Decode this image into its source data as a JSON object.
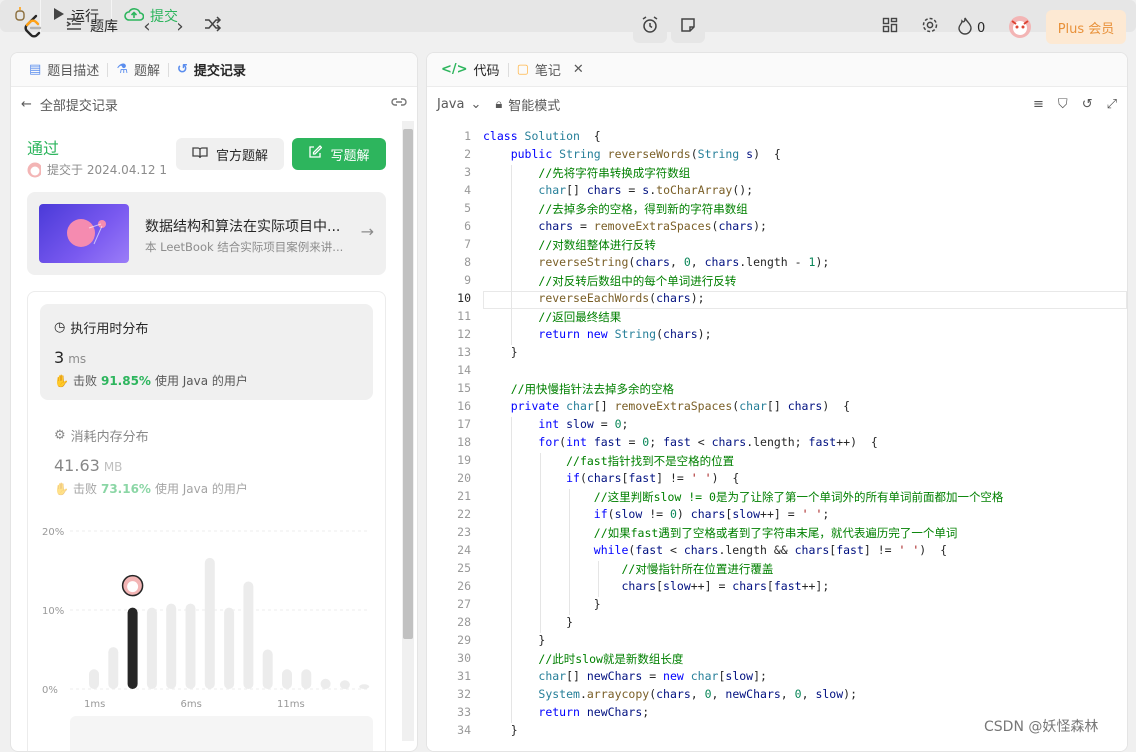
{
  "topbar": {
    "problem_bank": "题库",
    "run": "运行",
    "submit": "提交",
    "fire_count": "0",
    "plus": "Plus 会员"
  },
  "left": {
    "tabs": [
      "题目描述",
      "题解",
      "提交记录"
    ],
    "back_label": "全部提交记录",
    "status": "通过",
    "submit_time": "提交于 2024.04.12 1",
    "official_solution": "官方题解",
    "write_solution": "写题解",
    "card": {
      "title": "数据结构和算法在实际项目中...",
      "desc": "本 LeetBook 结合实际项目案例来讲..."
    },
    "runtime": {
      "label": "执行用时分布",
      "value": "3",
      "unit": "ms",
      "beat_prefix": "击败",
      "beat": "91.85%",
      "beat_suffix": "使用 Java 的用户"
    },
    "memory": {
      "label": "消耗内存分布",
      "value": "41.63",
      "unit": "MB",
      "beat_prefix": "击败",
      "beat": "73.16%",
      "beat_suffix": "使用 Java 的用户"
    }
  },
  "chart_data": {
    "type": "bar",
    "y_ticks": [
      "20%",
      "10%",
      "0%"
    ],
    "x_ticks": [
      "1ms",
      "6ms",
      "11ms"
    ],
    "ylim": [
      0,
      20
    ],
    "values": [
      2.5,
      5.3,
      10.3,
      10.3,
      10.8,
      10.8,
      16.6,
      10.3,
      13.6,
      5,
      2.5,
      2.5,
      1.3,
      1.1,
      0.6
    ],
    "highlight_index": 2
  },
  "right": {
    "tabs": [
      "代码",
      "笔记"
    ],
    "language": "Java",
    "mode": "智能模式",
    "active_line": 10,
    "lines": [
      [
        [
          "kw",
          "class "
        ],
        [
          "ty",
          "Solution"
        ],
        [
          "",
          "  {"
        ]
      ],
      [
        [
          "",
          "    "
        ],
        [
          "kw",
          "public "
        ],
        [
          "ty",
          "String "
        ],
        [
          "fn",
          "reverseWords"
        ],
        [
          "",
          "("
        ],
        [
          "ty",
          "String "
        ],
        [
          "vr",
          "s"
        ],
        [
          "",
          ")  {"
        ]
      ],
      [
        [
          "",
          "        "
        ],
        [
          "cm",
          "//先将字符串转换成字符数组"
        ]
      ],
      [
        [
          "",
          "        "
        ],
        [
          "ty",
          "char"
        ],
        [
          "",
          "[] "
        ],
        [
          "vr",
          "chars"
        ],
        [
          "",
          " = "
        ],
        [
          "vr",
          "s"
        ],
        [
          "",
          "."
        ],
        [
          "fn",
          "toCharArray"
        ],
        [
          "",
          "();"
        ]
      ],
      [
        [
          "",
          "        "
        ],
        [
          "cm",
          "//去掉多余的空格，得到新的字符串数组"
        ]
      ],
      [
        [
          "",
          "        "
        ],
        [
          "vr",
          "chars"
        ],
        [
          "",
          " = "
        ],
        [
          "fn",
          "removeExtraSpaces"
        ],
        [
          "",
          "("
        ],
        [
          "vr",
          "chars"
        ],
        [
          "",
          ");"
        ]
      ],
      [
        [
          "",
          "        "
        ],
        [
          "cm",
          "//对数组整体进行反转"
        ]
      ],
      [
        [
          "",
          "        "
        ],
        [
          "fn",
          "reverseString"
        ],
        [
          "",
          "("
        ],
        [
          "vr",
          "chars"
        ],
        [
          "",
          ", "
        ],
        [
          "nm",
          "0"
        ],
        [
          "",
          ", "
        ],
        [
          "vr",
          "chars"
        ],
        [
          "",
          ".length - "
        ],
        [
          "nm",
          "1"
        ],
        [
          "",
          ");"
        ]
      ],
      [
        [
          "",
          "        "
        ],
        [
          "cm",
          "//对反转后数组中的每个单词进行反转"
        ]
      ],
      [
        [
          "",
          "        "
        ],
        [
          "fn",
          "reverseEachWords"
        ],
        [
          "",
          "("
        ],
        [
          "vr",
          "chars"
        ],
        [
          "",
          ");"
        ]
      ],
      [
        [
          "",
          "        "
        ],
        [
          "cm",
          "//返回最终结果"
        ]
      ],
      [
        [
          "",
          "        "
        ],
        [
          "kw",
          "return "
        ],
        [
          "kw",
          "new "
        ],
        [
          "ty",
          "String"
        ],
        [
          "",
          "("
        ],
        [
          "vr",
          "chars"
        ],
        [
          "",
          ");"
        ]
      ],
      [
        [
          "",
          "    }"
        ]
      ],
      [
        [
          "",
          ""
        ]
      ],
      [
        [
          "",
          "    "
        ],
        [
          "cm",
          "//用快慢指针法去掉多余的空格"
        ]
      ],
      [
        [
          "",
          "    "
        ],
        [
          "kw",
          "private "
        ],
        [
          "ty",
          "char"
        ],
        [
          "",
          "[] "
        ],
        [
          "fn",
          "removeExtraSpaces"
        ],
        [
          "",
          "("
        ],
        [
          "ty",
          "char"
        ],
        [
          "",
          "[] "
        ],
        [
          "vr",
          "chars"
        ],
        [
          "",
          ")  {"
        ]
      ],
      [
        [
          "",
          "        "
        ],
        [
          "kw",
          "int "
        ],
        [
          "vr",
          "slow"
        ],
        [
          "",
          " = "
        ],
        [
          "nm",
          "0"
        ],
        [
          "",
          ";"
        ]
      ],
      [
        [
          "",
          "        "
        ],
        [
          "kw",
          "for"
        ],
        [
          "",
          "("
        ],
        [
          "kw",
          "int "
        ],
        [
          "vr",
          "fast"
        ],
        [
          "",
          " = "
        ],
        [
          "nm",
          "0"
        ],
        [
          "",
          "; "
        ],
        [
          "vr",
          "fast"
        ],
        [
          "",
          " < "
        ],
        [
          "vr",
          "chars"
        ],
        [
          "",
          ".length; "
        ],
        [
          "vr",
          "fast"
        ],
        [
          "",
          "++)  {"
        ]
      ],
      [
        [
          "",
          "            "
        ],
        [
          "cm",
          "//fast指针找到不是空格的位置"
        ]
      ],
      [
        [
          "",
          "            "
        ],
        [
          "kw",
          "if"
        ],
        [
          "",
          "("
        ],
        [
          "vr",
          "chars"
        ],
        [
          "",
          "["
        ],
        [
          "vr",
          "fast"
        ],
        [
          "",
          "] != "
        ],
        [
          "st",
          "' '"
        ],
        [
          "",
          ")  {"
        ]
      ],
      [
        [
          "",
          "                "
        ],
        [
          "cm",
          "//这里判断slow != 0是为了让除了第一个单词外的所有单词前面都加一个空格"
        ]
      ],
      [
        [
          "",
          "                "
        ],
        [
          "kw",
          "if"
        ],
        [
          "",
          "("
        ],
        [
          "vr",
          "slow"
        ],
        [
          "",
          " != "
        ],
        [
          "nm",
          "0"
        ],
        [
          "",
          ") "
        ],
        [
          "vr",
          "chars"
        ],
        [
          "",
          "["
        ],
        [
          "vr",
          "slow"
        ],
        [
          "",
          "++] = "
        ],
        [
          "st",
          "' '"
        ],
        [
          "",
          ";"
        ]
      ],
      [
        [
          "",
          "                "
        ],
        [
          "cm",
          "//如果fast遇到了空格或者到了字符串末尾，就代表遍历完了一个单词"
        ]
      ],
      [
        [
          "",
          "                "
        ],
        [
          "kw",
          "while"
        ],
        [
          "",
          "("
        ],
        [
          "vr",
          "fast"
        ],
        [
          "",
          " < "
        ],
        [
          "vr",
          "chars"
        ],
        [
          "",
          ".length && "
        ],
        [
          "vr",
          "chars"
        ],
        [
          "",
          "["
        ],
        [
          "vr",
          "fast"
        ],
        [
          "",
          "] != "
        ],
        [
          "st",
          "' '"
        ],
        [
          "",
          ")  {"
        ]
      ],
      [
        [
          "",
          "                    "
        ],
        [
          "cm",
          "//对慢指针所在位置进行覆盖"
        ]
      ],
      [
        [
          "",
          "                    "
        ],
        [
          "vr",
          "chars"
        ],
        [
          "",
          "["
        ],
        [
          "vr",
          "slow"
        ],
        [
          "",
          "++] = "
        ],
        [
          "vr",
          "chars"
        ],
        [
          "",
          "["
        ],
        [
          "vr",
          "fast"
        ],
        [
          "",
          "++];"
        ]
      ],
      [
        [
          "",
          "                }"
        ]
      ],
      [
        [
          "",
          "            }"
        ]
      ],
      [
        [
          "",
          "        }"
        ]
      ],
      [
        [
          "",
          "        "
        ],
        [
          "cm",
          "//此时slow就是新数组长度"
        ]
      ],
      [
        [
          "",
          "        "
        ],
        [
          "ty",
          "char"
        ],
        [
          "",
          "[] "
        ],
        [
          "vr",
          "newChars"
        ],
        [
          "",
          " = "
        ],
        [
          "kw",
          "new "
        ],
        [
          "ty",
          "char"
        ],
        [
          "",
          "["
        ],
        [
          "vr",
          "slow"
        ],
        [
          "",
          "];"
        ]
      ],
      [
        [
          "",
          "        "
        ],
        [
          "ty",
          "System"
        ],
        [
          "",
          "."
        ],
        [
          "fn",
          "arraycopy"
        ],
        [
          "",
          "("
        ],
        [
          "vr",
          "chars"
        ],
        [
          "",
          ", "
        ],
        [
          "nm",
          "0"
        ],
        [
          "",
          ", "
        ],
        [
          "vr",
          "newChars"
        ],
        [
          "",
          ", "
        ],
        [
          "nm",
          "0"
        ],
        [
          "",
          ", "
        ],
        [
          "vr",
          "slow"
        ],
        [
          "",
          ");"
        ]
      ],
      [
        [
          "",
          "        "
        ],
        [
          "kw",
          "return "
        ],
        [
          "vr",
          "newChars"
        ],
        [
          "",
          ";"
        ]
      ],
      [
        [
          "",
          "    }"
        ]
      ]
    ]
  },
  "watermark": "CSDN @妖怪森林"
}
